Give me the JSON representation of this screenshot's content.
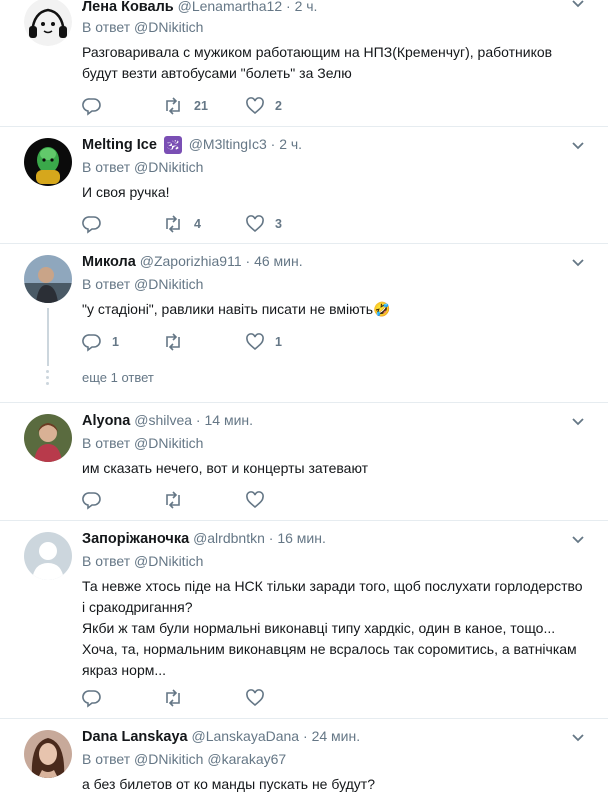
{
  "replies": [
    {
      "name": "Лена Коваль",
      "name_suffix": "",
      "handle": "@Lenamartha12",
      "time": "2 ч.",
      "replying_prefix": "В ответ",
      "mention": "@DNikitich",
      "mention2": "",
      "text": "Разговаривала с мужиком работающим на НПЗ(Кременчуг), работников будут везти  автобусами \"болеть\" за Зелю",
      "retweets": "21",
      "likes": "2",
      "replies_count": ""
    },
    {
      "name": "Melting Ice",
      "name_suffix": "🕉",
      "handle": "@M3ltingIc3",
      "time": "2 ч.",
      "replying_prefix": "В ответ",
      "mention": "@DNikitich",
      "mention2": "",
      "text": "И своя ручка!",
      "retweets": "4",
      "likes": "3",
      "replies_count": ""
    },
    {
      "name": "Микола",
      "name_suffix": "",
      "handle": "@Zaporizhia911",
      "time": "46 мин.",
      "replying_prefix": "В ответ",
      "mention": "@DNikitich",
      "mention2": "",
      "text": "\"у стадіоні\", равлики навіть писати не вміють🤣",
      "retweets": "",
      "likes": "1",
      "replies_count": "1",
      "more_label": "еще 1 ответ"
    },
    {
      "name": "Alyona",
      "name_suffix": "",
      "handle": "@shilvea",
      "time": "14 мин.",
      "replying_prefix": "В ответ",
      "mention": "@DNikitich",
      "mention2": "",
      "text": "им сказать нечего, вот и концерты затевают",
      "retweets": "",
      "likes": "",
      "replies_count": ""
    },
    {
      "name": "Запоріжаночка",
      "name_suffix": "",
      "handle": "@alrdbntkn",
      "time": "16 мин.",
      "replying_prefix": "В ответ",
      "mention": "@DNikitich",
      "mention2": "",
      "text_lines": [
        "Та невже хтось піде на НСК тільки заради того, щоб послухати горлодерство і сракодригання?",
        "Якби ж там були нормальні виконавці типу хардкіс, один в каное, тощо...",
        "Хоча, та, нормальним виконавцям не всралось так соромитись, а ватнічкам якраз норм..."
      ],
      "retweets": "",
      "likes": "",
      "replies_count": ""
    },
    {
      "name": "Dana Lanskaya",
      "name_suffix": "",
      "handle": "@LanskayaDana",
      "time": "24 мин.",
      "replying_prefix": "В ответ",
      "mention": "@DNikitich",
      "mention2": "@karakay67",
      "text": "а без билетов от ко манды пускать не будут?",
      "retweets": "",
      "likes": "",
      "replies_count": ""
    }
  ],
  "separator": "·",
  "icons": {
    "reply": "reply-icon",
    "retweet": "retweet-icon",
    "like": "heart-icon",
    "caret": "chevron-down-icon"
  },
  "colors": {
    "secondary_text": "#657786",
    "border": "#e6ecf0",
    "primary_text": "#14171a"
  }
}
